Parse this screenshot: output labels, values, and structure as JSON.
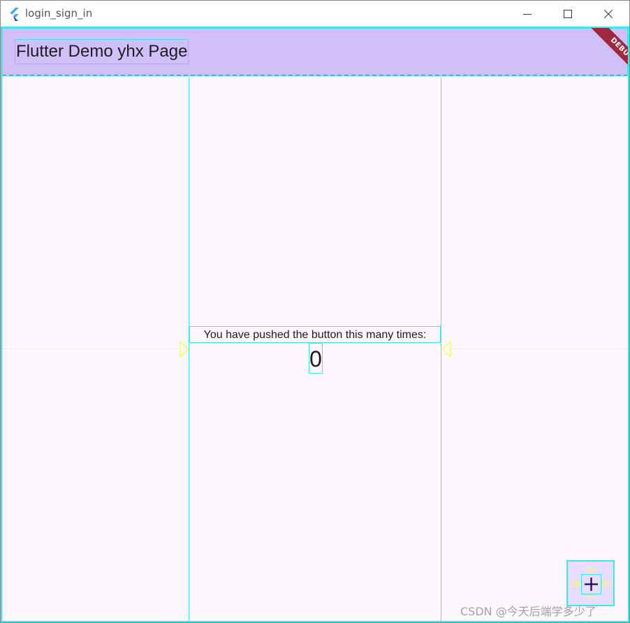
{
  "window": {
    "title": "login_sign_in",
    "icon": "flutter-logo-icon",
    "controls": [
      "minimize-icon",
      "maximize-icon",
      "close-icon"
    ]
  },
  "appbar": {
    "title": "Flutter Demo yhx Page",
    "background": "#d1bff9",
    "debug_banner": "DEBUG"
  },
  "body": {
    "counter_label": "You have pushed the button this many times:",
    "counter_value": "0",
    "background": "#fdf8fd"
  },
  "fab": {
    "icon": "plus-icon",
    "background": "#e9ddff"
  },
  "watermark": "CSDN @今天后端学多少了",
  "colors": {
    "debug_outline": "#3fe6ef",
    "debug_arrow": "#ffff33",
    "baseline_dash": "#b249e0",
    "debug_ribbon": "#a0283c"
  }
}
